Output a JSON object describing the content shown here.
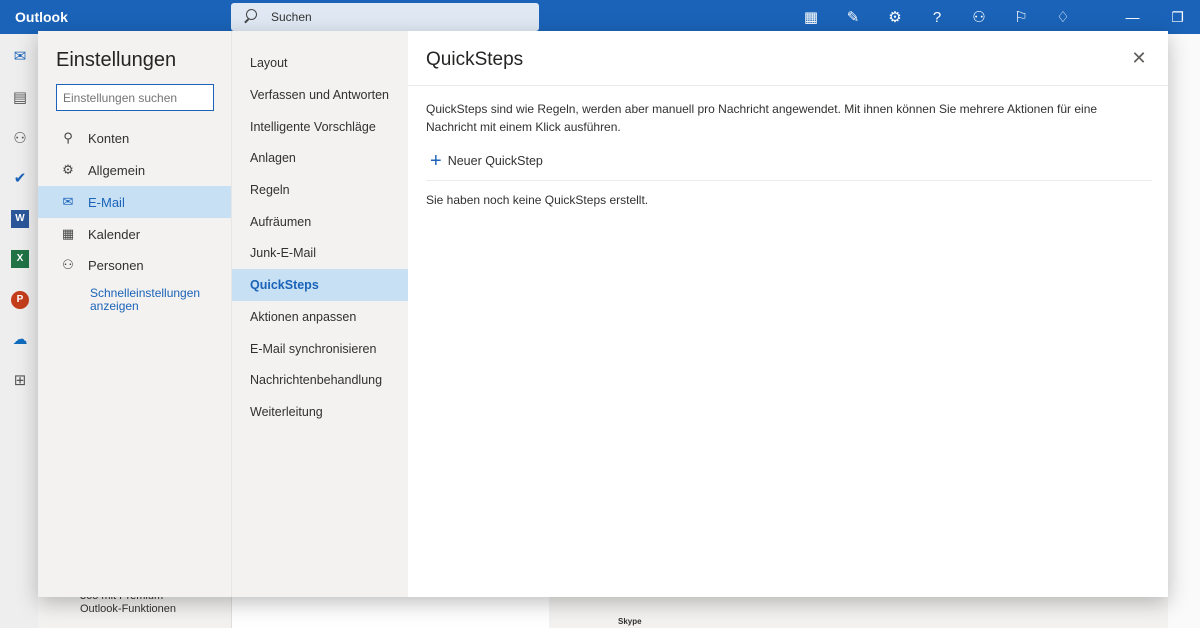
{
  "app": {
    "title": "Outlook"
  },
  "search": {
    "placeholder": "Suchen"
  },
  "topbar_icons": [
    "grid-icon",
    "tag-icon",
    "gear-icon",
    "help-icon",
    "people-icon",
    "chat-icon",
    "lightbulb-icon"
  ],
  "window_controls": [
    "minimize",
    "restore"
  ],
  "rail": [
    "mail-icon",
    "calendar-icon",
    "people-icon",
    "todo-icon",
    "word-icon",
    "excel-icon",
    "powerpoint-icon",
    "onedrive-icon",
    "apps-icon"
  ],
  "background": {
    "promo_line1": "365 mit Premium-",
    "promo_line2": "Outlook-Funktionen",
    "skype": "Skype"
  },
  "settings": {
    "title": "Einstellungen",
    "search_placeholder": "Einstellungen suchen",
    "categories": [
      {
        "label": "Konten",
        "icon": "person-icon"
      },
      {
        "label": "Allgemein",
        "icon": "gear-icon"
      },
      {
        "label": "E-Mail",
        "icon": "mail-icon",
        "active": true
      },
      {
        "label": "Kalender",
        "icon": "calendar-icon"
      },
      {
        "label": "Personen",
        "icon": "people-icon"
      }
    ],
    "quick_settings_link": "Schnelleinstellungen anzeigen",
    "subcategories": [
      "Layout",
      "Verfassen und Antworten",
      "Intelligente Vorschläge",
      "Anlagen",
      "Regeln",
      "Aufräumen",
      "Junk-E-Mail",
      "QuickSteps",
      "Aktionen anpassen",
      "E-Mail synchronisieren",
      "Nachrichtenbehandlung",
      "Weiterleitung"
    ],
    "active_subcategory": "QuickSteps",
    "panel": {
      "title": "QuickSteps",
      "description": "QuickSteps sind wie Regeln, werden aber manuell pro Nachricht angewendet. Mit ihnen können Sie mehrere Aktionen für eine Nachricht mit einem Klick ausführen.",
      "new_button": "Neuer QuickStep",
      "empty_text": "Sie haben noch keine QuickSteps erstellt."
    }
  },
  "colors": {
    "accent": "#1a63b8",
    "selected_bg": "#c7e0f4"
  }
}
